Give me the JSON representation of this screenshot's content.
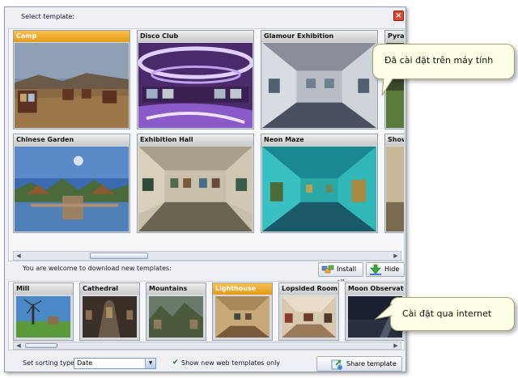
{
  "dialog": {
    "title": "Select template:",
    "close_icon": "close-icon"
  },
  "installed_templates": [
    {
      "name": "Camp",
      "selected": true
    },
    {
      "name": "Disco Club",
      "selected": false
    },
    {
      "name": "Glamour Exhibition",
      "selected": false
    },
    {
      "name": "Pyrami",
      "selected": false
    },
    {
      "name": "Chinese Garden",
      "selected": false
    },
    {
      "name": "Exhibition Hall",
      "selected": false
    },
    {
      "name": "Neon Maze",
      "selected": false
    },
    {
      "name": "Showro",
      "selected": false
    }
  ],
  "web_section": {
    "label": "You are welcome to download new templates:",
    "install_all": "Install all",
    "hide": "Hide"
  },
  "web_templates": [
    {
      "name": "Mill",
      "selected": false
    },
    {
      "name": "Cathedral",
      "selected": false
    },
    {
      "name": "Mountains",
      "selected": false
    },
    {
      "name": "Lighthouse",
      "selected": true
    },
    {
      "name": "Lopsided Room",
      "selected": false
    },
    {
      "name": "Moon Observat...",
      "selected": false
    }
  ],
  "footer": {
    "sort_label": "Set sorting type:",
    "sort_value": "Date",
    "show_new_label": "Show new web templates only",
    "show_new_checked": true,
    "share_label": "Share template"
  },
  "callouts": {
    "installed": "Đã cài đặt trên máy tính",
    "internet": "Cài đặt qua internet"
  },
  "colors": {
    "selected_caption": "#e49a16",
    "close_button": "#d94a2a"
  }
}
